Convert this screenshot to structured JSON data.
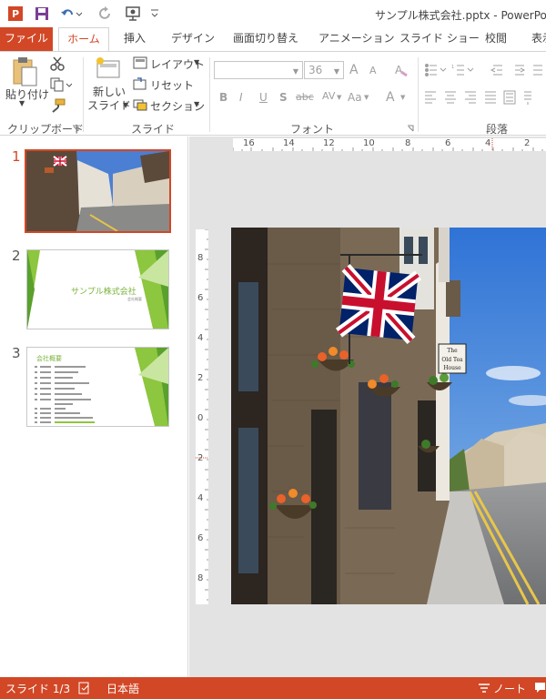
{
  "titlebar": {
    "title": "サンプル株式会社.pptx - PowerPoint"
  },
  "tabs": {
    "file": "ファイル",
    "home": "ホーム",
    "insert": "挿入",
    "design": "デザイン",
    "transitions": "画面切り替え",
    "animations": "アニメーション",
    "slideshow": "スライド ショー",
    "review": "校閲",
    "view": "表示"
  },
  "ribbon": {
    "clipboard": {
      "paste": "貼り付け",
      "label": "クリップボード"
    },
    "slides": {
      "new_slide_line1": "新しい",
      "new_slide_line2": "スライド",
      "layout": "レイアウト",
      "reset": "リセット",
      "section": "セクション",
      "label": "スライド"
    },
    "font": {
      "font_name": "",
      "font_size": "36",
      "bold": "B",
      "italic": "I",
      "underline": "U",
      "shadow": "S",
      "strike": "abc",
      "spacing": "AV",
      "case": "Aa",
      "grow": "A",
      "shrink": "A",
      "color": "A",
      "label": "フォント"
    },
    "paragraph": {
      "label": "段落"
    }
  },
  "thumbnails": {
    "items": [
      {
        "number": "1"
      },
      {
        "number": "2",
        "title": "サンプル株式会社",
        "subtitle": "会社概要"
      },
      {
        "number": "3",
        "title": "会社概要"
      }
    ]
  },
  "ruler": {
    "horizontal": [
      "16",
      "14",
      "12",
      "10",
      "8",
      "6",
      "4",
      "2"
    ],
    "vertical": [
      "8",
      "6",
      "4",
      "2",
      "0",
      "2",
      "4",
      "6",
      "8"
    ]
  },
  "slide_photo": {
    "sign_line1": "The",
    "sign_line2": "Old Tea",
    "sign_line3": "House"
  },
  "status": {
    "slide": "スライド 1/3",
    "language": "日本語",
    "notes": "ノート"
  },
  "colors": {
    "accent": "#d24726",
    "green": "#8dc63f"
  }
}
